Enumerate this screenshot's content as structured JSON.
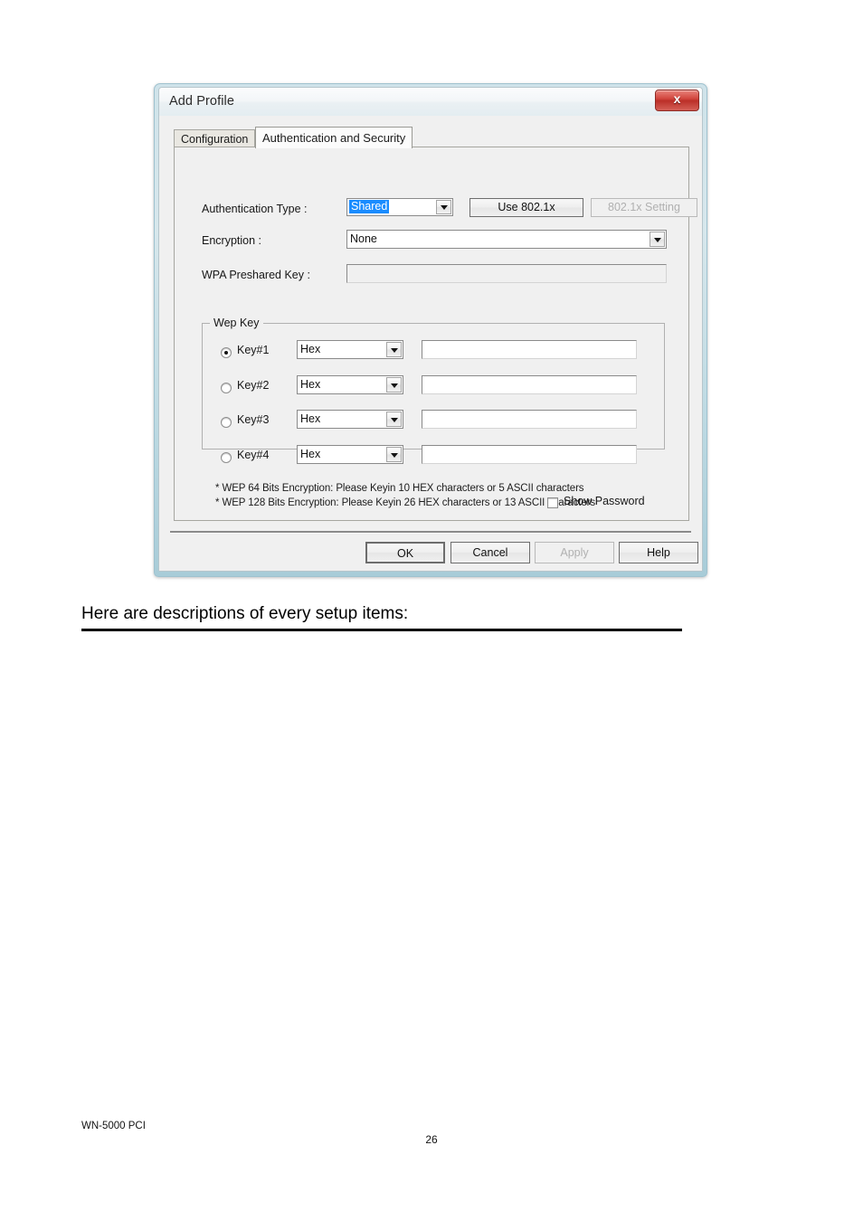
{
  "page": {
    "caption": "Here are descriptions of every setup items:",
    "footer_model": "WN-5000 PCI",
    "page_number": "26"
  },
  "dialog": {
    "title": "Add Profile",
    "close_icon": "close-x-icon",
    "tabs": [
      {
        "label": "Configuration",
        "active": false
      },
      {
        "label": "Authentication and Security",
        "active": true
      }
    ],
    "fields": {
      "auth_type_label": "Authentication Type :",
      "auth_type_value": "Shared",
      "auth_type_selected": true,
      "use_8021x_label": "Use 802.1x",
      "setting_8021x_label": "802.1x Setting",
      "setting_8021x_disabled": true,
      "encryption_label": "Encryption :",
      "encryption_value": "None",
      "wpa_preshared_label": "WPA Preshared Key :",
      "wpa_preshared_value": "",
      "wpa_preshared_disabled": true
    },
    "wep_group": {
      "title": "Wep Key",
      "keys": [
        {
          "label": "Key#1",
          "format": "Hex",
          "value": "",
          "selected": true
        },
        {
          "label": "Key#2",
          "format": "Hex",
          "value": "",
          "selected": false
        },
        {
          "label": "Key#3",
          "format": "Hex",
          "value": "",
          "selected": false
        },
        {
          "label": "Key#4",
          "format": "Hex",
          "value": "",
          "selected": false
        }
      ],
      "notes": [
        "* WEP 64 Bits Encryption:  Please Keyin 10 HEX characters or 5 ASCII characters",
        "* WEP 128 Bits Encryption:  Please Keyin 26 HEX characters or 13 ASCII characters"
      ]
    },
    "show_password_label": "Show Password",
    "show_password_checked": false,
    "buttons": {
      "ok": "OK",
      "cancel": "Cancel",
      "apply": "Apply",
      "apply_disabled": true,
      "help": "Help"
    },
    "colors": {
      "selection_blue": "#1a8cff",
      "close_red": "#c7362e",
      "window_frame": "#bcd9e2",
      "client_bg": "#f0f0f0"
    }
  }
}
